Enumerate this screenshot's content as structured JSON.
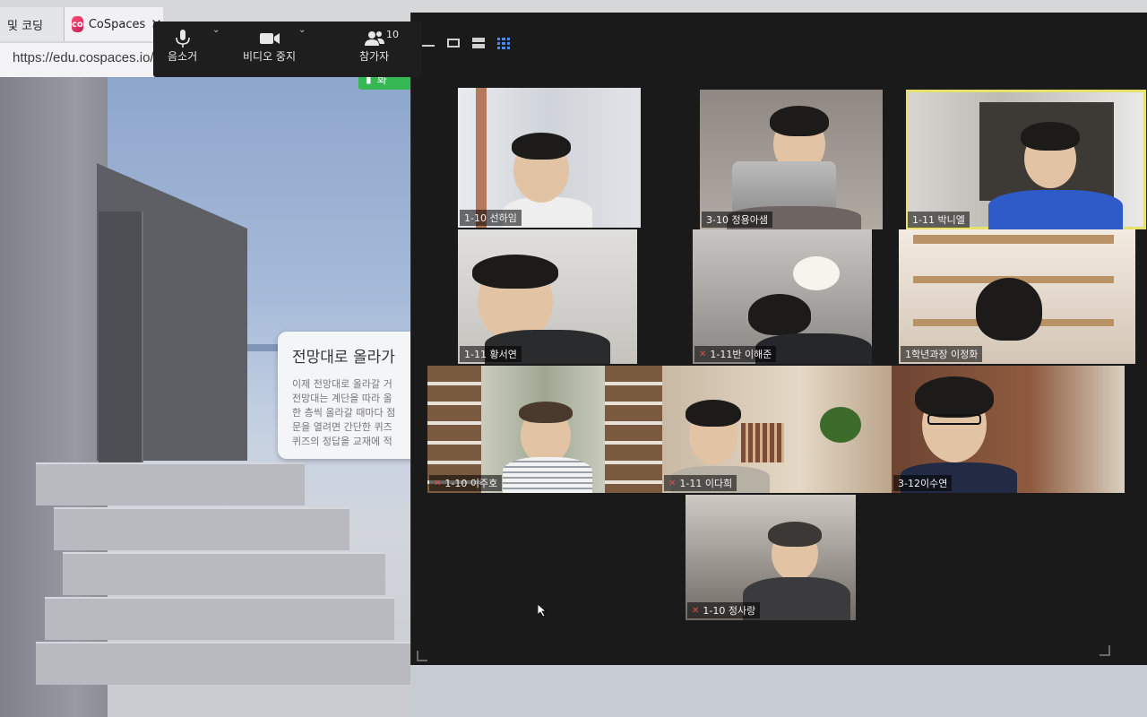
{
  "browser": {
    "tabs": [
      {
        "label": "및 코딩"
      },
      {
        "label": "CoSpaces",
        "close_glyph": "✕"
      }
    ],
    "url": "https://edu.cospaces.io/",
    "chip_label": "화"
  },
  "scene_card": {
    "title": "전망대로 올라가",
    "lines": [
      "이제 전망대로 올라갈 거",
      "전망대는 계단을 따라 올",
      "한 층씩 올라갈 때마다 점",
      "문을 열려면 간단한 퀴즈",
      "퀴즈의 정답을 교재에 적"
    ]
  },
  "zoom": {
    "toolbar": {
      "mute_label": "음소거",
      "video_label": "비디오 중지",
      "participants_label": "참가자",
      "participant_count": "10"
    },
    "tiles": [
      {
        "name": "1-10 선하임",
        "muted": false,
        "active": false
      },
      {
        "name": "3-10 정용아샘",
        "muted": false,
        "active": false
      },
      {
        "name": "1-11 박니엘",
        "muted": false,
        "active": true
      },
      {
        "name": "1-11 황서연",
        "muted": false,
        "active": false
      },
      {
        "name": "1-11반 이해준",
        "muted": true,
        "active": false
      },
      {
        "name": "1학년과장 이정화",
        "muted": false,
        "active": false
      },
      {
        "name": "1-10 이주호",
        "muted": true,
        "active": false
      },
      {
        "name": "1-11 이다희",
        "muted": true,
        "active": false
      },
      {
        "name": "3-12이수연",
        "muted": false,
        "active": false
      },
      {
        "name": "1-10 정사랑",
        "muted": true,
        "active": false
      }
    ],
    "grid_view_color": "#4a8cf7",
    "active_speaker_color": "#e6e16a"
  }
}
